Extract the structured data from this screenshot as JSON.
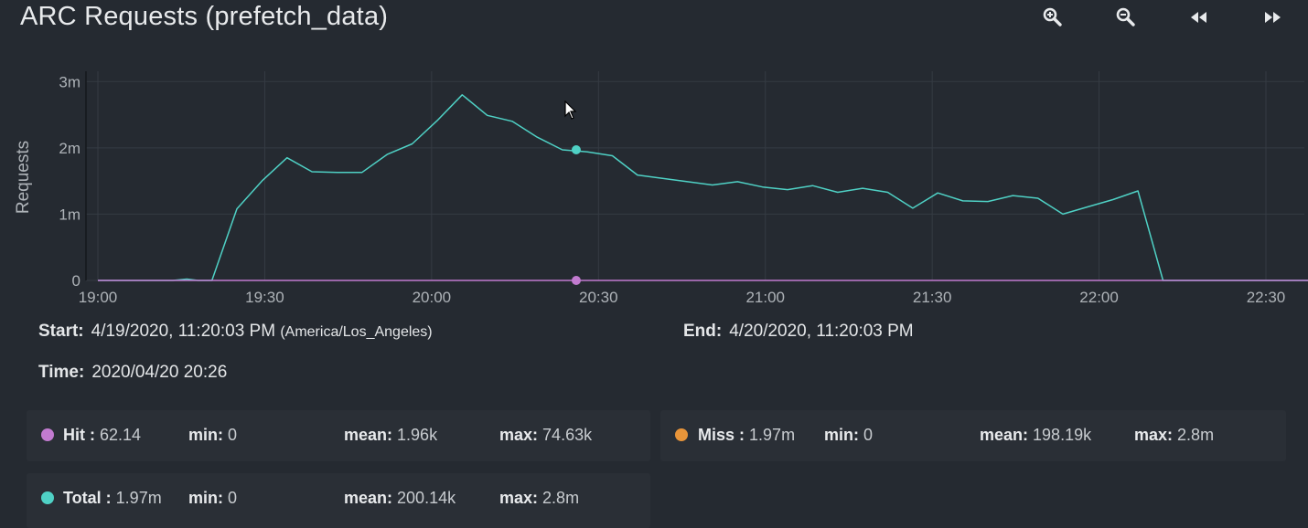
{
  "title": "ARC Requests (prefetch_data)",
  "toolbar": {
    "zoom_in": "zoom-in-icon",
    "zoom_out": "zoom-out-icon",
    "back": "rewind-icon",
    "forward": "fast-forward-icon"
  },
  "chart_data": {
    "type": "line",
    "ylabel": "Requests",
    "xlabel": "",
    "y_tick_labels": [
      "0",
      "1m",
      "2m",
      "3m"
    ],
    "y_tick_values": [
      0,
      1000000,
      2000000,
      3000000
    ],
    "ylim": [
      0,
      3100000
    ],
    "x_tick_labels": [
      "19:00",
      "19:30",
      "20:00",
      "20:30",
      "21:00",
      "21:30",
      "22:00",
      "22:30"
    ],
    "x_tick_minutes": [
      0,
      30,
      60,
      90,
      120,
      150,
      180,
      210
    ],
    "xlim_minutes": [
      0,
      218
    ],
    "grid": true,
    "series": [
      {
        "name": "Total",
        "color": "#4fd1c5",
        "x_minutes": [
          0,
          4.5,
          9,
          13.5,
          16,
          18,
          20.5,
          25,
          29.5,
          34,
          38.5,
          43,
          47.5,
          52,
          56.5,
          61,
          65.5,
          70,
          74.5,
          79,
          83.5,
          88,
          92.5,
          97,
          101.5,
          106,
          110.5,
          115,
          119.5,
          124,
          128.5,
          133,
          137.5,
          142,
          146.5,
          151,
          155.5,
          160,
          164.5,
          169,
          173.5,
          178,
          182.5,
          187,
          191.5,
          196,
          200.5,
          205,
          209.5,
          218
        ],
        "values": [
          0,
          0,
          0,
          0,
          20000,
          0,
          0,
          1080000,
          1500000,
          1850000,
          1640000,
          1630000,
          1630000,
          1900000,
          2060000,
          2410000,
          2800000,
          2490000,
          2400000,
          2160000,
          1970000,
          1940000,
          1880000,
          1590000,
          1540000,
          1490000,
          1440000,
          1490000,
          1410000,
          1370000,
          1430000,
          1330000,
          1390000,
          1330000,
          1090000,
          1320000,
          1200000,
          1190000,
          1280000,
          1240000,
          1000000,
          1110000,
          1220000,
          1350000,
          0,
          0,
          0,
          0,
          0,
          0
        ]
      },
      {
        "name": "Hit",
        "color": "#c27bd0",
        "x_minutes": [
          0,
          218
        ],
        "values": [
          0,
          0
        ]
      }
    ],
    "hover_minute": 86,
    "hover_points": [
      {
        "series": "Total",
        "value": 1970000,
        "color": "#4fd1c5"
      },
      {
        "series": "Hit",
        "value": 62.14,
        "color": "#c27bd0"
      }
    ]
  },
  "info": {
    "start_label": "Start:",
    "start_value": "4/19/2020, 11:20:03 PM",
    "start_tz": "(America/Los_Angeles)",
    "end_label": "End:",
    "end_value": "4/20/2020, 11:20:03 PM",
    "time_label": "Time:",
    "time_value": "2020/04/20 20:26"
  },
  "legend": [
    {
      "name": "Hit",
      "color": "#c27bd0",
      "current": "62.14",
      "min": "0",
      "mean": "1.96k",
      "max": "74.63k"
    },
    {
      "name": "Miss",
      "color": "#e8953a",
      "current": "1.97m",
      "min": "0",
      "mean": "198.19k",
      "max": "2.8m"
    },
    {
      "name": "Total",
      "color": "#4fd1c5",
      "current": "1.97m",
      "min": "0",
      "mean": "200.14k",
      "max": "2.8m"
    }
  ],
  "labels": {
    "sep": " : ",
    "min": "min:",
    "mean": "mean:",
    "max": "max:"
  }
}
